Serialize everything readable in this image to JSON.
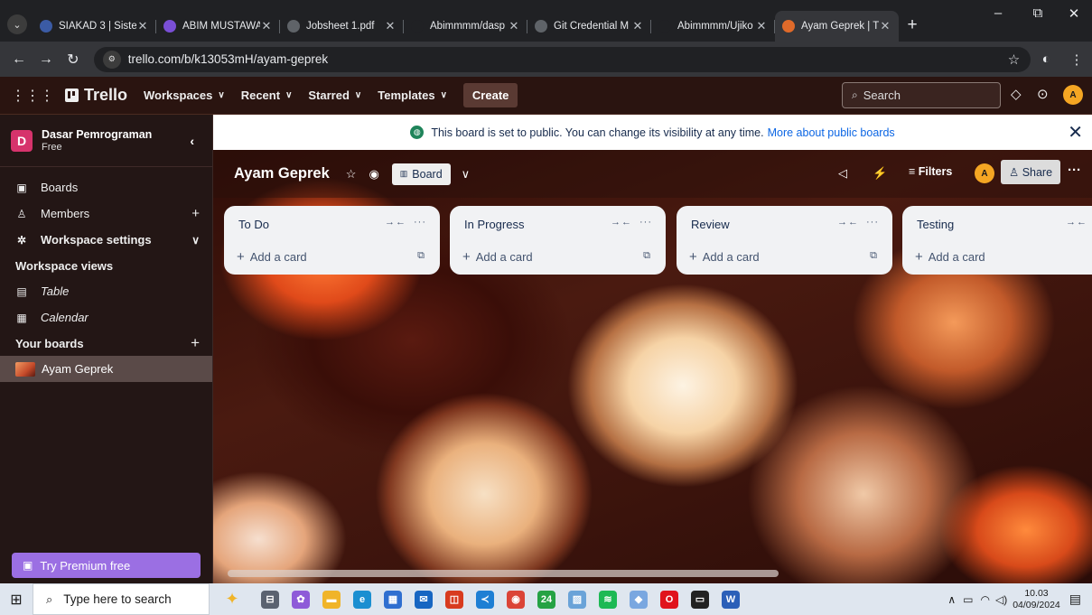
{
  "browser": {
    "tabs": [
      {
        "title": "SIAKAD 3 | Sistem",
        "favicon_color": "#3b5ba5"
      },
      {
        "title": "ABIM MUSTAWA",
        "favicon_color": "#7a4fd6"
      },
      {
        "title": "Jobsheet 1.pdf",
        "favicon_color": "#5f6368"
      },
      {
        "title": "Abimmmm/dasp",
        "favicon_color": "#202124"
      },
      {
        "title": "Git Credential M",
        "favicon_color": "#5f6368"
      },
      {
        "title": "Abimmmm/Ujiko",
        "favicon_color": "#202124"
      },
      {
        "title": "Ayam Geprek | T",
        "favicon_color": "#e06a2a",
        "active": true
      }
    ],
    "new_tab": "+",
    "window_controls": {
      "minimize": "–",
      "restore": "⧉",
      "close": "✕"
    },
    "url": "trello.com/b/k13053mH/ayam-geprek"
  },
  "header": {
    "logo_text": "Trello",
    "nav": [
      "Workspaces",
      "Recent",
      "Starred",
      "Templates"
    ],
    "create_label": "Create",
    "search_placeholder": "Search",
    "avatar_initial": "A"
  },
  "sidebar": {
    "workspace_initial": "D",
    "workspace_name": "Dasar Pemrograman",
    "workspace_plan": "Free",
    "items": [
      {
        "label": "Boards",
        "icon": "board-icon"
      },
      {
        "label": "Members",
        "icon": "person-icon",
        "right": "+"
      },
      {
        "label": "Workspace settings",
        "icon": "gear-icon",
        "right": "⌄"
      }
    ],
    "views_title": "Workspace views",
    "views": [
      {
        "label": "Table",
        "icon": "table-icon"
      },
      {
        "label": "Calendar",
        "icon": "calendar-icon"
      }
    ],
    "boards_title": "Your boards",
    "boards": [
      {
        "label": "Ayam Geprek"
      }
    ],
    "premium_label": "Try Premium free"
  },
  "notice": {
    "text": "This board is set to public. You can change its visibility at any time.",
    "link": "More about public boards"
  },
  "board": {
    "title": "Ayam Geprek",
    "view_label": "Board",
    "filters_label": "Filters",
    "share_label": "Share",
    "member_initial": "A",
    "lists": [
      {
        "name": "To Do",
        "add_label": "Add a card"
      },
      {
        "name": "In Progress",
        "add_label": "Add a card"
      },
      {
        "name": "Review",
        "add_label": "Add a card"
      },
      {
        "name": "Testing",
        "add_label": "Add a card"
      }
    ]
  },
  "taskbar": {
    "search_placeholder": "Type here to search",
    "apps": [
      {
        "name": "task-view",
        "color": "#5a6270",
        "glyph": "⊟"
      },
      {
        "name": "copilot",
        "color": "#8e5bd8",
        "glyph": "✿"
      },
      {
        "name": "file-explorer",
        "color": "#f0b429",
        "glyph": "▬"
      },
      {
        "name": "edge",
        "color": "#1b8fd1",
        "glyph": "e"
      },
      {
        "name": "store",
        "color": "#2f6fd0",
        "glyph": "▦"
      },
      {
        "name": "mail",
        "color": "#1766c2",
        "glyph": "✉"
      },
      {
        "name": "office",
        "color": "#d83b1f",
        "glyph": "◫"
      },
      {
        "name": "vscode",
        "color": "#1e7fd4",
        "glyph": "≺"
      },
      {
        "name": "chrome",
        "color": "#db4437",
        "glyph": "◉"
      },
      {
        "name": "whatsapp",
        "color": "#25a244",
        "glyph": "24"
      },
      {
        "name": "photos",
        "color": "#6aa3d8",
        "glyph": "▨"
      },
      {
        "name": "spotify",
        "color": "#1db954",
        "glyph": "≋"
      },
      {
        "name": "git",
        "color": "#7aa7e0",
        "glyph": "◆"
      },
      {
        "name": "opera",
        "color": "#e0131c",
        "glyph": "O"
      },
      {
        "name": "terminal",
        "color": "#222222",
        "glyph": "▭"
      },
      {
        "name": "word",
        "color": "#2b5fb8",
        "glyph": "W"
      }
    ],
    "time": "10.03",
    "date": "04/09/2024"
  }
}
